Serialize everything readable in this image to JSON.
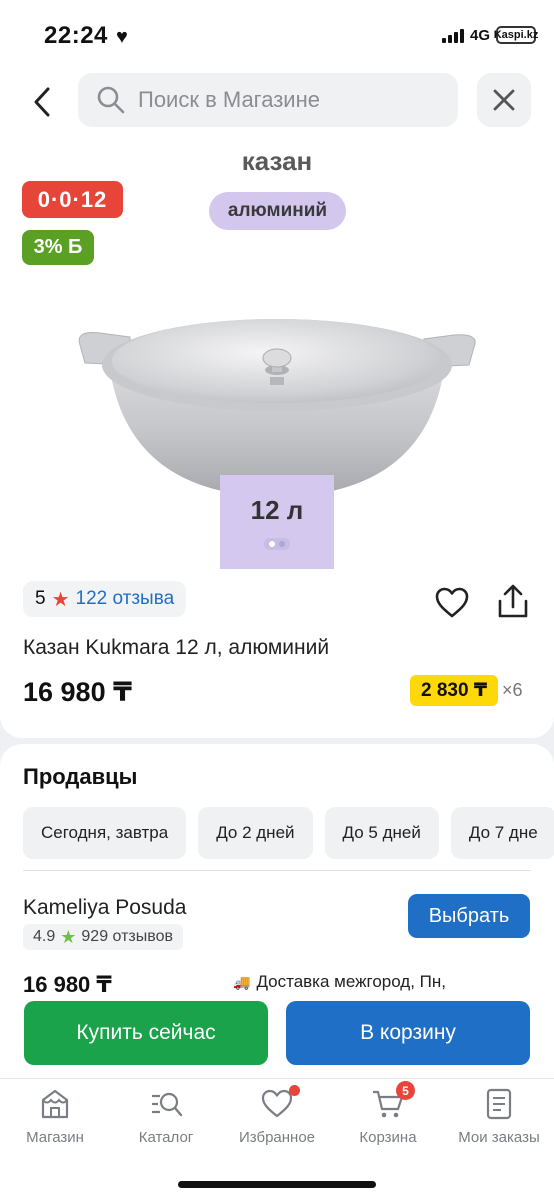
{
  "status_bar": {
    "time": "22:24",
    "network": "4G",
    "battery_text": "Kaspi.kz"
  },
  "search": {
    "placeholder": "Поиск в Магазине"
  },
  "product": {
    "image_label": "казан",
    "material": "алюминий",
    "installment_badge": "0·0·12",
    "bonus_badge": "3% Б",
    "volume": "12 л",
    "rating": "5",
    "reviews": "122 отзыва",
    "title": "Казан Kukmara 12 л, алюминий",
    "price": "16 980 ₸",
    "monthly_payment": "2 830 ₸",
    "months": "×6"
  },
  "sellers": {
    "title": "Продавцы",
    "filters": [
      "Сегодня, завтра",
      "До 2 дней",
      "До 5 дней",
      "До 7 дне"
    ],
    "items": [
      {
        "name": "Kameliya Posuda",
        "rating": "4.9",
        "reviews": "929 отзывов",
        "choose_label": "Выбрать",
        "price": "16 980 ₸",
        "delivery": "Доставка межгород, Пн,"
      }
    ]
  },
  "actions": {
    "buy_now": "Купить сейчас",
    "add_to_cart": "В корзину"
  },
  "tabs": [
    {
      "label": "Магазин",
      "icon": "store-icon"
    },
    {
      "label": "Каталог",
      "icon": "catalog-search-icon"
    },
    {
      "label": "Избранное",
      "icon": "heart-icon"
    },
    {
      "label": "Корзина",
      "icon": "cart-icon",
      "badge": "5"
    },
    {
      "label": "Мои заказы",
      "icon": "orders-icon"
    }
  ],
  "colors": {
    "accent_blue": "#1f6fc6",
    "buy_green": "#1aa34a",
    "installment_red": "#e8453a",
    "bonus_green": "#5aa024",
    "monthly_yellow": "#ffd80a",
    "material_lilac": "#d4c7ee"
  }
}
